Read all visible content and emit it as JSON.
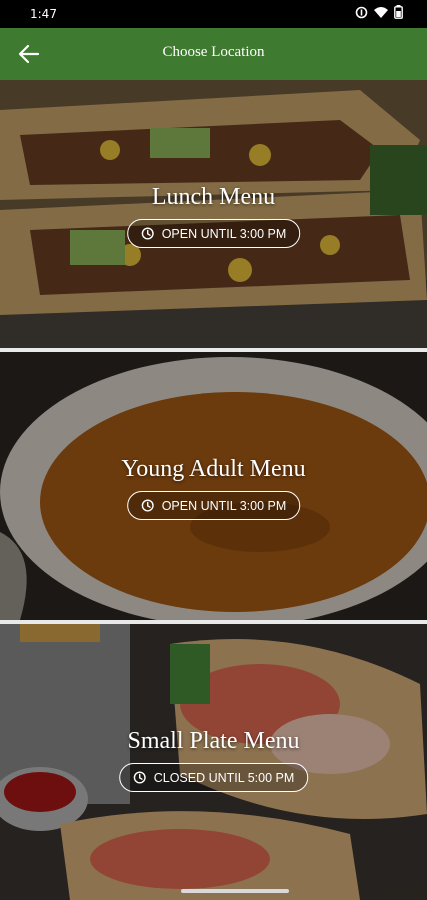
{
  "status": {
    "time": "1:47"
  },
  "header": {
    "title": "Choose Location"
  },
  "menus": [
    {
      "title": "Lunch Menu",
      "hours": "OPEN UNTIL 3:00 PM"
    },
    {
      "title": "Young Adult Menu",
      "hours": "OPEN UNTIL 3:00 PM"
    },
    {
      "title": "Small Plate Menu",
      "hours": "CLOSED UNTIL 5:00 PM"
    }
  ],
  "colors": {
    "app_bar": "#3e7a2f",
    "text": "#ffffff"
  },
  "icons": {
    "back": "arrow-left-icon",
    "hours": "clock-icon"
  }
}
